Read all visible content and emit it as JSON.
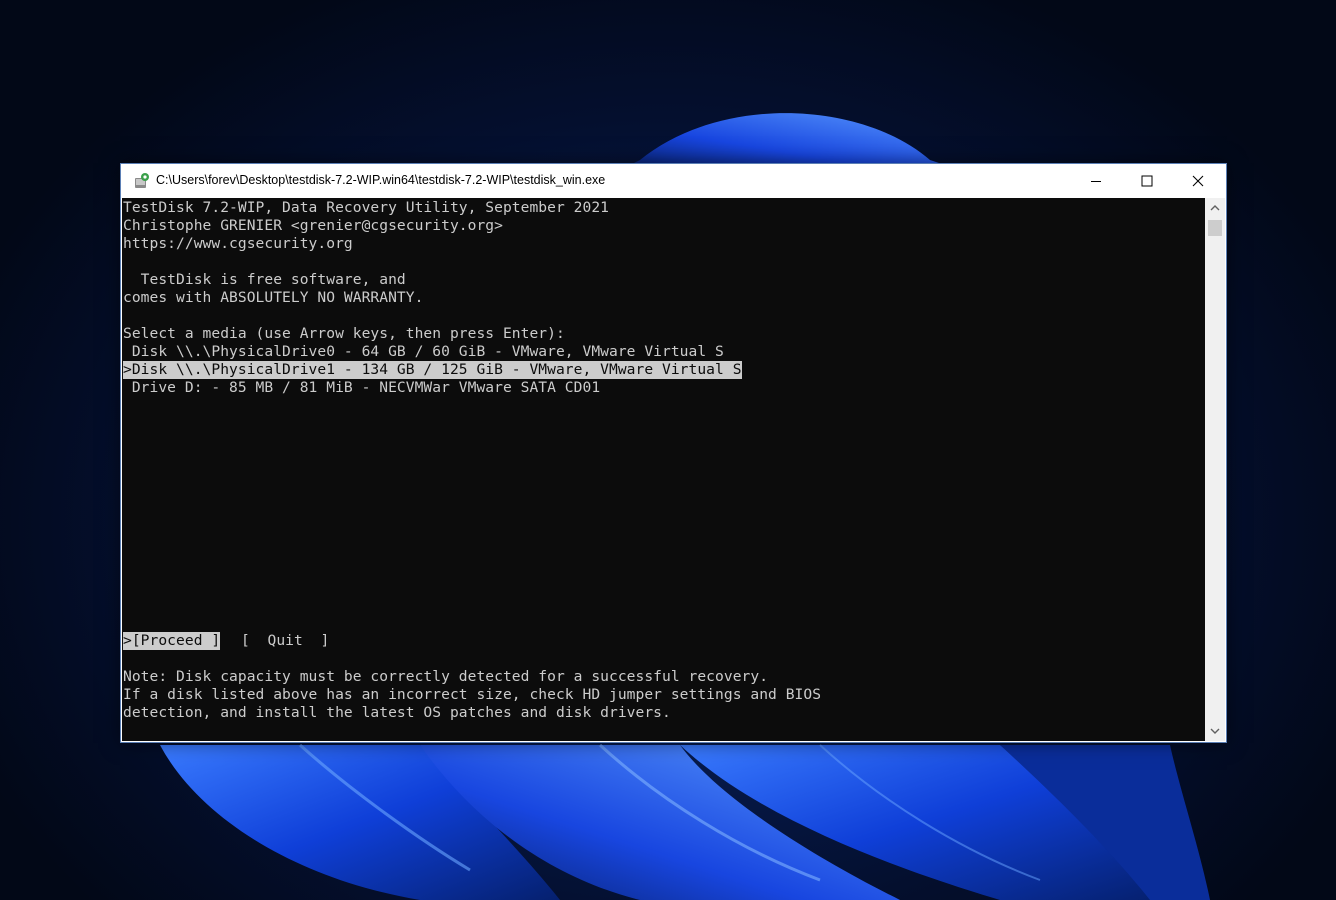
{
  "window": {
    "title": "C:\\Users\\forev\\Desktop\\testdisk-7.2-WIP.win64\\testdisk-7.2-WIP\\testdisk_win.exe"
  },
  "console": {
    "header": [
      "TestDisk 7.2-WIP, Data Recovery Utility, September 2021",
      "Christophe GRENIER <grenier@cgsecurity.org>",
      "https://www.cgsecurity.org"
    ],
    "license": [
      "  TestDisk is free software, and",
      "comes with ABSOLUTELY NO WARRANTY."
    ],
    "prompt": "Select a media (use Arrow keys, then press Enter):",
    "media": [
      " Disk \\\\.\\PhysicalDrive0 - 64 GB / 60 GiB - VMware, VMware Virtual S",
      ">Disk \\\\.\\PhysicalDrive1 - 134 GB / 125 GiB - VMware, VMware Virtual S",
      " Drive D: - 85 MB / 81 MiB - NECVMWar VMware SATA CD01"
    ],
    "menu": {
      "proceed": ">[Proceed ]",
      "quit": "[  Quit  ]"
    },
    "note": [
      "Note: Disk capacity must be correctly detected for a successful recovery.",
      "If a disk listed above has an incorrect size, check HD jumper settings and BIOS",
      "detection, and install the latest OS patches and disk drivers."
    ]
  },
  "icons": {
    "app": "testdisk-app-icon",
    "minimize": "minimize-icon",
    "maximize": "maximize-icon",
    "close": "close-icon",
    "scroll_up": "scroll-up-arrow-icon",
    "scroll_down": "scroll-down-arrow-icon"
  },
  "colors": {
    "console_bg": "#0c0c0c",
    "console_fg": "#cccccc",
    "highlight_bg": "#cccccc",
    "desktop_accent": "#1a4fff"
  }
}
